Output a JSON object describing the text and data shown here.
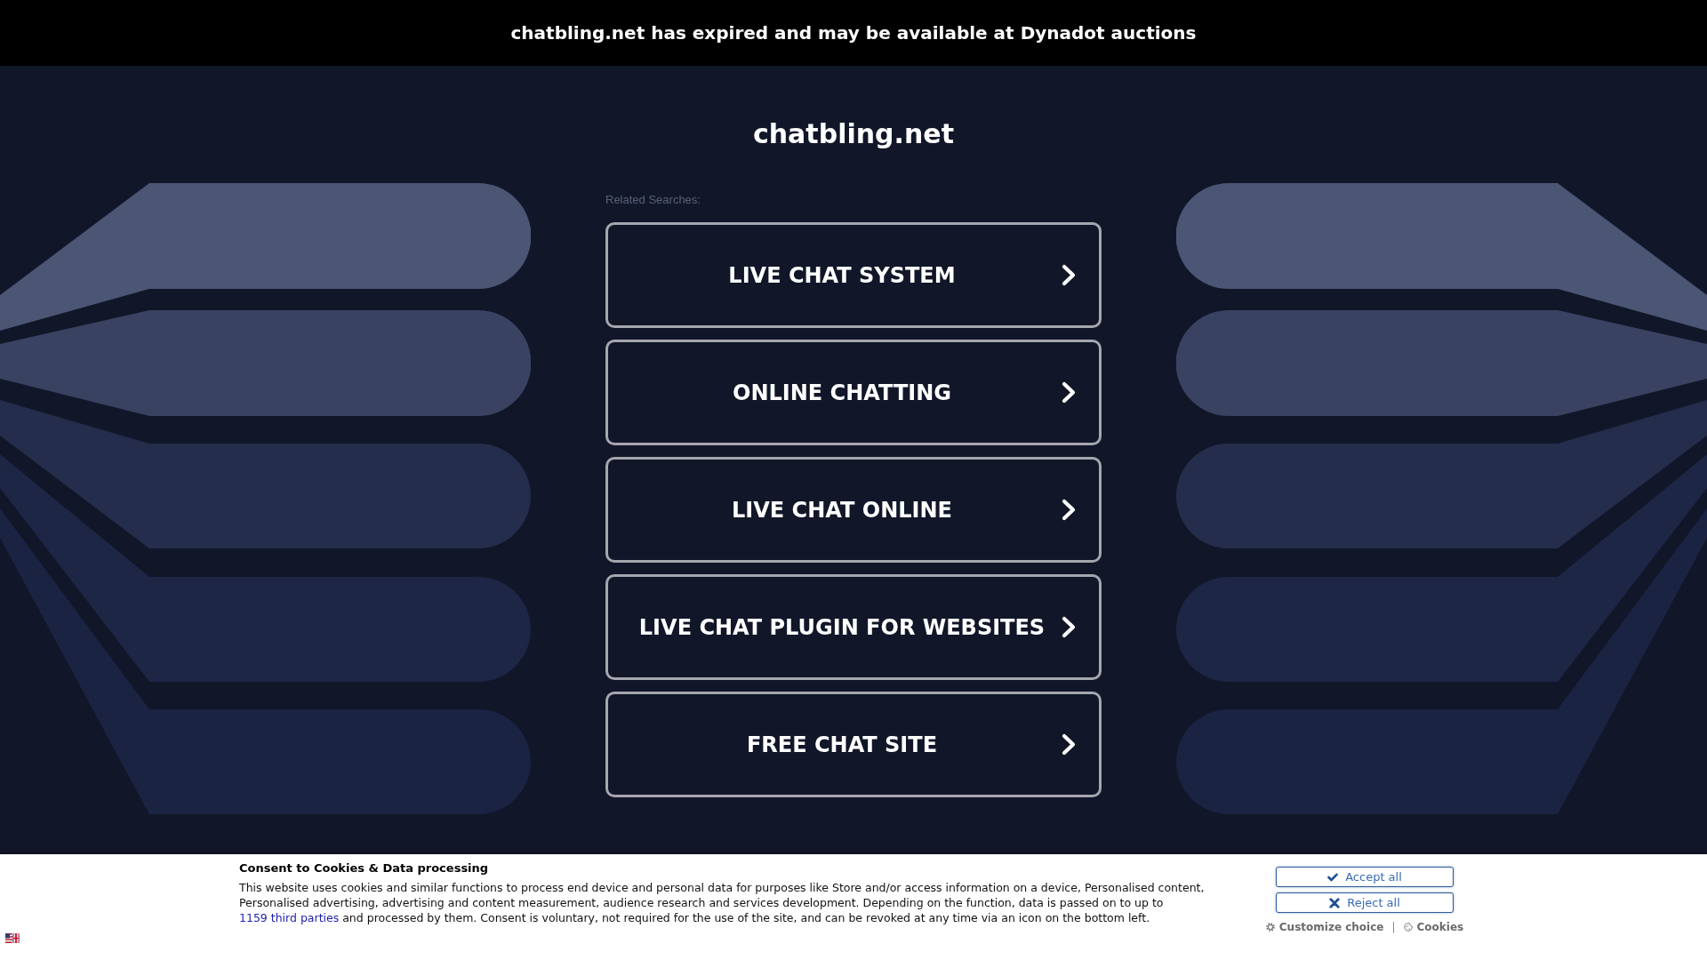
{
  "top_banner": {
    "text": "chatbling.net has expired and may be available at Dynadot auctions"
  },
  "domain_title": "chatbling.net",
  "related_searches": {
    "label": "Related Searches:",
    "items": [
      "LIVE CHAT SYSTEM",
      "ONLINE CHATTING",
      "LIVE CHAT ONLINE",
      "LIVE CHAT PLUGIN FOR WEBSITES",
      "FREE CHAT SITE"
    ]
  },
  "cookie_consent": {
    "title": "Consent to Cookies & Data processing",
    "text_before": "This website uses cookies and similar functions to process end device and personal data for purposes like Store and/or access information on a device, Personalised content, Personalised advertising, advertising and content measurement, audience research and services development. Depending on the function, data is passed on to up to",
    "link": "1159 third parties",
    "text_after": "and processed by them. Consent is voluntary, not required for the use of the site, and can be revoked at any time via an icon on the bottom left.",
    "buttons": [
      {
        "kind": "accept",
        "label": "Accept all"
      },
      {
        "kind": "reject",
        "label": "Reject all"
      }
    ],
    "links": [
      {
        "kind": "customize",
        "label": "Customize choice"
      },
      {
        "kind": "cookies",
        "label": "Cookies"
      }
    ],
    "separator": "|"
  }
}
